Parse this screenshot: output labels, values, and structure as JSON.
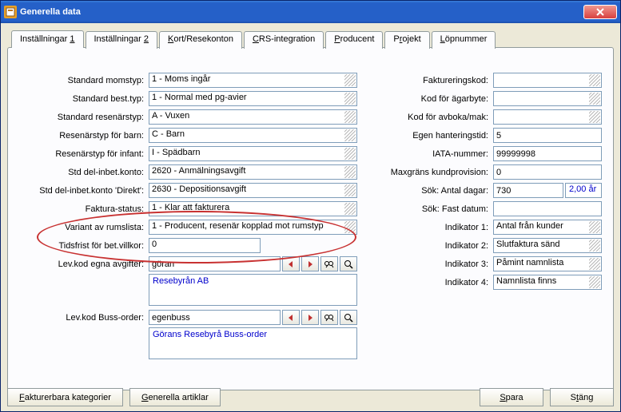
{
  "window": {
    "title": "Generella data"
  },
  "tabs": [
    "Inställningar 1",
    "Inställningar 2",
    "Kort/Resekonton",
    "CRS-integration",
    "Producent",
    "Projekt",
    "Löpnummer"
  ],
  "tabsU": [
    "1",
    "2",
    "K",
    "C",
    "P",
    "P",
    "L"
  ],
  "left": {
    "momstyp": {
      "label": "Standard momstyp:",
      "val": "1  - Moms ingår"
    },
    "besttyp": {
      "label": "Standard best.typ:",
      "val": "1  - Normal med pg-avier"
    },
    "resenartyp": {
      "label": "Standard resenärstyp:",
      "val": "A  - Vuxen"
    },
    "barn": {
      "label": "Resenärstyp för barn:",
      "val": "C  - Barn"
    },
    "infant": {
      "label": "Resenärstyp för infant:",
      "val": "I   - Spädbarn"
    },
    "delinbet": {
      "label": "Std del-inbet.konto:",
      "val": "2620              - Anmälningsavgift"
    },
    "delinbetd": {
      "label": "Std del-inbet.konto 'Direkt':",
      "val": "2630              - Depositionsavgift"
    },
    "fakturastatus": {
      "label": "Faktura-status:",
      "val": "1  - Klar att fakturera"
    },
    "rumslista": {
      "label": "Variant av rumslista:",
      "val": "1  - Producent, resenär kopplad mot rumstyp"
    },
    "tidsfrist": {
      "label": "Tidsfrist för bet.villkor:",
      "val": "0"
    },
    "levkod": {
      "label": "Lev.kod egna avgifter:",
      "val": "göran",
      "desc": "Resebyrån AB"
    },
    "levbuss": {
      "label": "Lev.kod Buss-order:",
      "val": "egenbuss",
      "desc": "Görans Resebyrå Buss-order"
    }
  },
  "right": {
    "faktkod": {
      "label": "Faktureringskod:",
      "val": ""
    },
    "agarbyte": {
      "label": "Kod för ägarbyte:",
      "val": ""
    },
    "avboka": {
      "label": "Kod för avboka/mak:",
      "val": ""
    },
    "egen": {
      "label": "Egen hanteringstid:",
      "val": "5"
    },
    "iata": {
      "label": "IATA-nummer:",
      "val": "99999998"
    },
    "maxgrans": {
      "label": "Maxgräns kundprovision:",
      "val": "0"
    },
    "sokdagar": {
      "label": "Sök: Antal dagar:",
      "val": "730",
      "note": "2,00 år"
    },
    "sokfast": {
      "label": "Sök: Fast datum:",
      "val": ""
    },
    "ind1": {
      "label": "Indikator 1:",
      "val": "Antal från kunder"
    },
    "ind2": {
      "label": "Indikator 2:",
      "val": "Slutfaktura sänd"
    },
    "ind3": {
      "label": "Indikator 3:",
      "val": "Påmint namnlista"
    },
    "ind4": {
      "label": "Indikator 4:",
      "val": "Namnlista finns"
    }
  },
  "buttons": {
    "fakt": "Fakturerbara kategorier",
    "gen": "Generella artiklar",
    "spara": "Spara",
    "stang": "Stäng"
  }
}
